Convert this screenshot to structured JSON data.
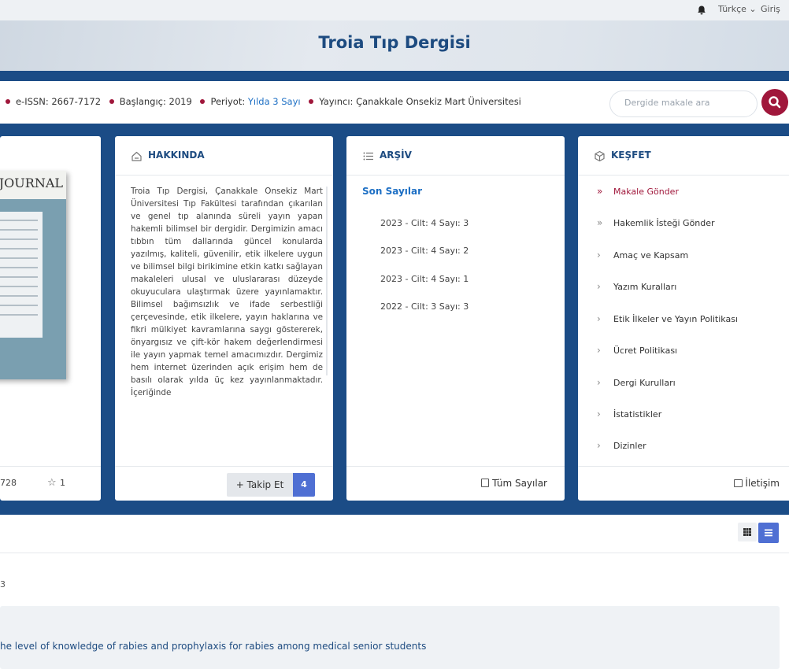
{
  "topbar": {
    "language": "Türkçe ⌄",
    "login": "Giriş"
  },
  "journal": {
    "title": "Troia Tıp Dergisi"
  },
  "info": {
    "issn_label": "e-ISSN:",
    "issn": "2667-7172",
    "start_label": "Başlangıç:",
    "start": "2019",
    "period_label": "Periyot:",
    "period": "Yılda 3 Sayı",
    "publisher_label": "Yayıncı:",
    "publisher": "Çanakkale Onsekiz Mart Üniversitesi"
  },
  "search": {
    "placeholder": "Dergide makale ara"
  },
  "cover_card": {
    "cover_text": "AL JOURNAL",
    "views": "728",
    "favorites": "1"
  },
  "about": {
    "heading": "HAKKINDA",
    "text": "Troia Tıp Dergisi, Çanakkale Onsekiz Mart Üniversitesi Tıp Fakültesi tarafından çıkarılan ve genel tıp alanında süreli yayın yapan hakemli bilimsel bir dergidir. Dergimizin amacı tıbbın tüm dallarında güncel konularda yazılmış, kaliteli, güvenilir, etik ilkelere uygun ve bilimsel bilgi birikimine etkin katkı sağlayan makaleleri ulusal ve uluslararası düzeyde okuyuculara ulaştırmak üzere yayınlamaktır. Bilimsel bağımsızlık ve ifade serbestliği çerçevesinde, etik ilkelere, yayın haklarına ve fikri mülkiyet kavramlarına saygı göstererek, önyargısız ve çift-kör hakem değerlendirmesi ile yayın yapmak temel amacımızdır. Dergimiz hem internet üzerinden açık erişim hem de basılı olarak yılda üç kez yayınlanmaktadır. İçeriğinde",
    "follow_label": "+ Takip Et",
    "follow_count": "4"
  },
  "archive": {
    "heading": "ARŞİV",
    "recent_label": "Son Sayılar",
    "issues": [
      "2023 - Cilt: 4 Sayı: 3",
      "2023 - Cilt: 4 Sayı: 2",
      "2023 - Cilt: 4 Sayı: 1",
      "2022 - Cilt: 3 Sayı: 3"
    ],
    "all_issues_label": "Tüm Sayılar"
  },
  "explore": {
    "heading": "KEŞFET",
    "items": [
      "Makale Gönder",
      "Hakemlik İsteği Gönder",
      "Amaç ve Kapsam",
      "Yazım Kuralları",
      "Etik İlkeler ve Yayın Politikası",
      "Ücret Politikası",
      "Dergi Kurulları",
      "İstatistikler",
      "Dizinler"
    ],
    "contact_label": "İletişim"
  },
  "listing": {
    "issue_label": "3",
    "article_title": "he level of knowledge of rabies and prophylaxis for rabies among medical senior students"
  },
  "colors": {
    "brand_blue": "#1b4c86",
    "accent_red": "#a0173b",
    "link_blue": "#1d6fc4",
    "toggle_blue": "#4f6fd3"
  }
}
